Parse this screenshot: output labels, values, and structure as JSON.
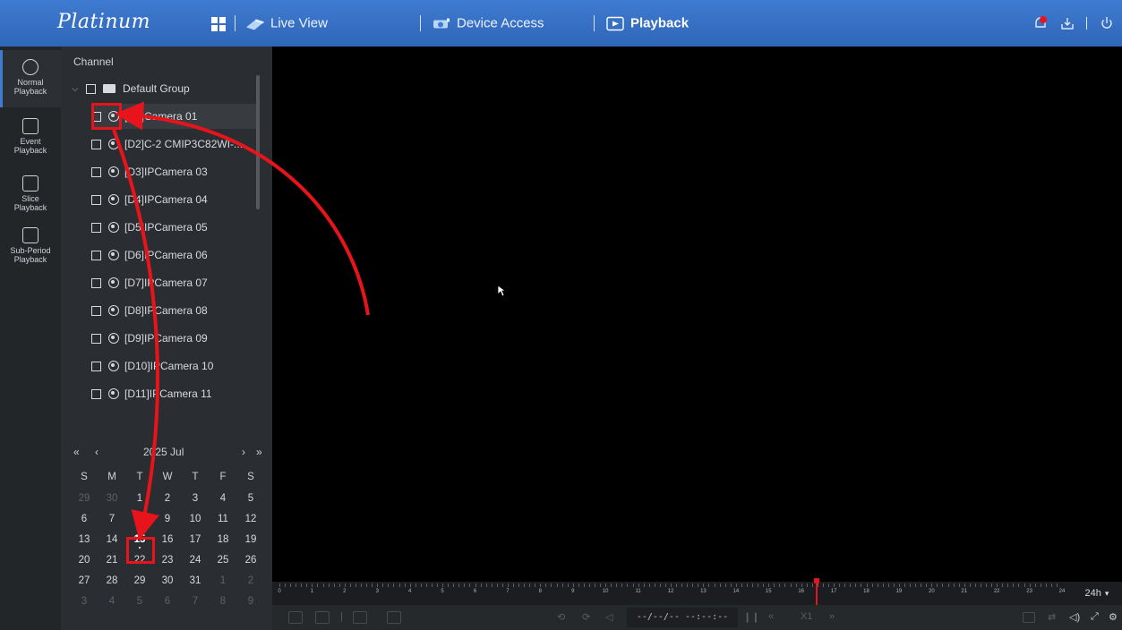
{
  "app": {
    "logo": "Platinum"
  },
  "nav": {
    "tabs": [
      {
        "label": "Live View"
      },
      {
        "label": "Device Access"
      },
      {
        "label": "Playback"
      }
    ]
  },
  "rail": {
    "items": [
      {
        "label": "Normal Playback"
      },
      {
        "label": "Event Playback"
      },
      {
        "label": "Slice Playback"
      },
      {
        "label": "Sub-Period Playback"
      }
    ]
  },
  "panel": {
    "title": "Channel",
    "group": "Default Group",
    "channels": [
      "[D1]Camera 01",
      "[D2]C-2 CMIP3C82WI-...",
      "[D3]IPCamera 03",
      "[D4]IPCamera 04",
      "[D5]IPCamera 05",
      "[D6]IPCamera 06",
      "[D7]IPCamera 07",
      "[D8]IPCamera 08",
      "[D9]IPCamera 09",
      "[D10]IPCamera 10",
      "[D11]IPCamera 11"
    ]
  },
  "calendar": {
    "month_label": "2025 Jul",
    "weekdays": [
      "S",
      "M",
      "T",
      "W",
      "T",
      "F",
      "S"
    ],
    "rows": [
      [
        "29",
        "30",
        "1",
        "2",
        "3",
        "4",
        "5"
      ],
      [
        "6",
        "7",
        "8",
        "9",
        "10",
        "11",
        "12"
      ],
      [
        "13",
        "14",
        "15",
        "16",
        "17",
        "18",
        "19"
      ],
      [
        "20",
        "21",
        "22",
        "23",
        "24",
        "25",
        "26"
      ],
      [
        "27",
        "28",
        "29",
        "30",
        "31",
        "1",
        "2"
      ],
      [
        "3",
        "4",
        "5",
        "6",
        "7",
        "8",
        "9"
      ]
    ],
    "selected_day": "15"
  },
  "timeline": {
    "hours": [
      "0",
      "1",
      "2",
      "3",
      "4",
      "5",
      "6",
      "7",
      "8",
      "9",
      "10",
      "11",
      "12",
      "13",
      "14",
      "15",
      "16",
      "17",
      "18",
      "19",
      "20",
      "21",
      "22",
      "23",
      "24"
    ],
    "zoom": "24h"
  },
  "controls": {
    "time_display": "--/--/-- --:--:--",
    "speed": "X1"
  },
  "colors": {
    "accent": "#3f7bd0",
    "highlight": "#e8141c"
  }
}
